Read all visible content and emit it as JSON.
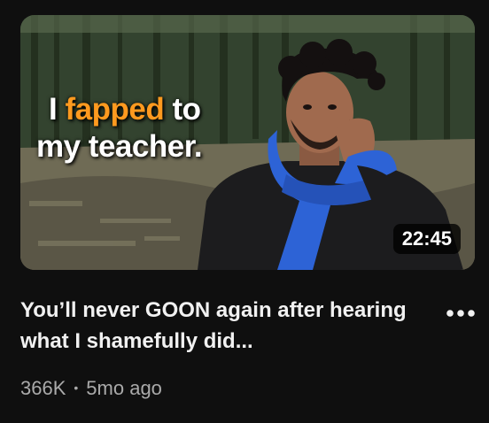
{
  "video": {
    "thumbnail_text": {
      "line1_prefix": "I",
      "line1_highlight": "fapped",
      "line1_suffix": "to",
      "line2": "my teacher."
    },
    "duration": "22:45",
    "title": "You’ll never GOON again after hearing what I shamefully did...",
    "views": "366K",
    "separator": "•",
    "age": "5mo ago"
  },
  "icons": {
    "menu": "more-vert-icon"
  },
  "colors": {
    "background": "#0f0f0f",
    "title": "#f1f1f1",
    "meta": "#aaaaaa",
    "highlight": "#ff9a1f",
    "scarf": "#2d63d6"
  }
}
